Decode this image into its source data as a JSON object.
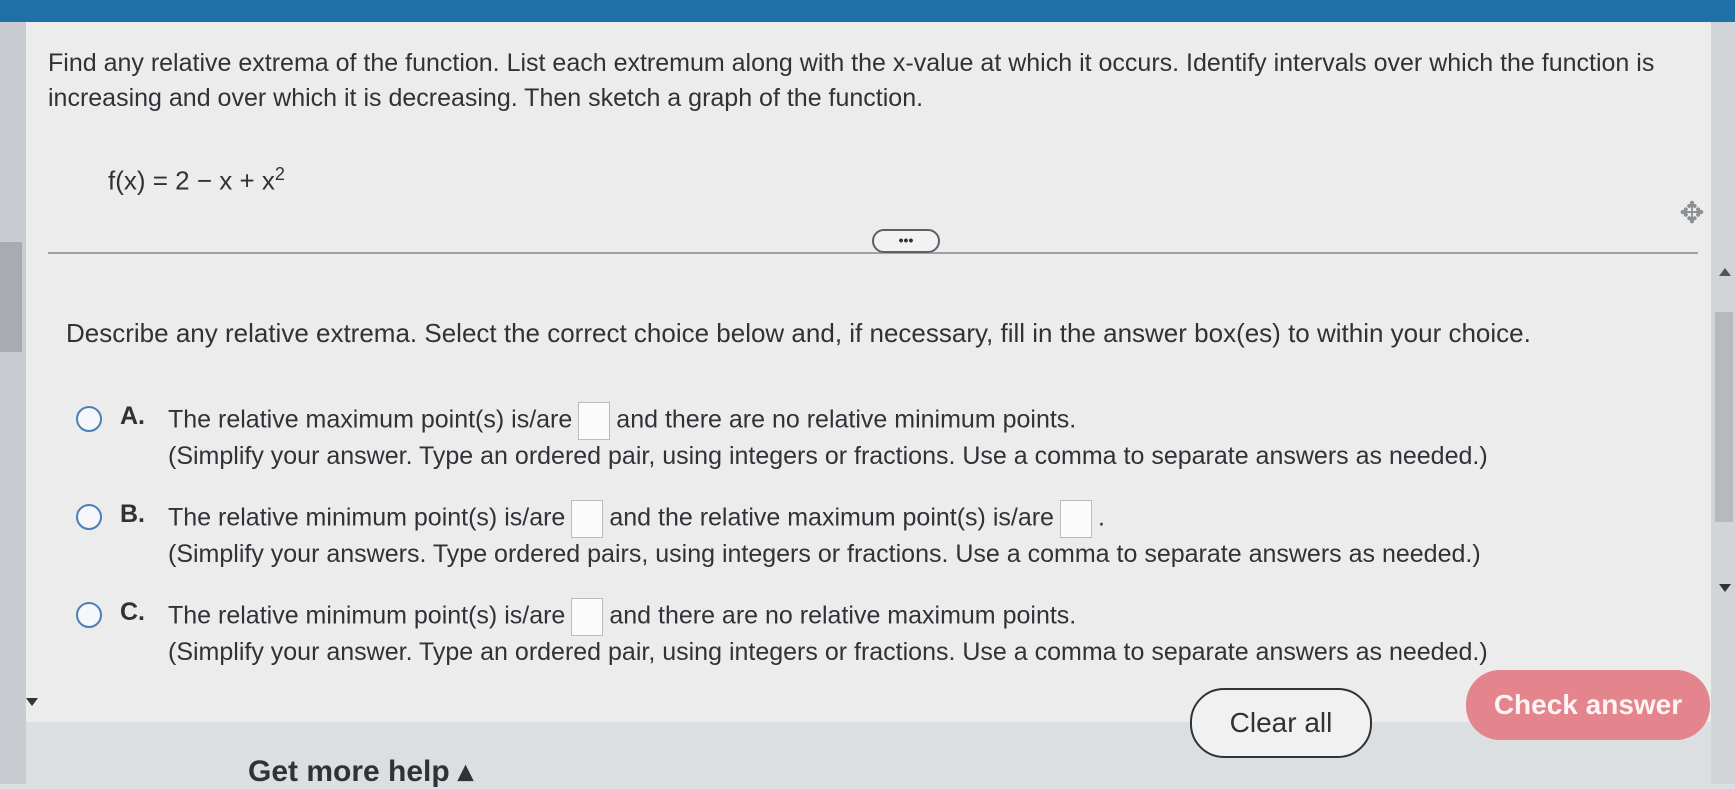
{
  "question": {
    "text": "Find any relative extrema of the function. List each extremum along with the x-value at which it occurs. Identify intervals over which the function is increasing and over which it is decreasing. Then sketch a graph of the function."
  },
  "function": {
    "lhs": "f(x) = 2 − x + x",
    "exponent": "2"
  },
  "more_button": "•••",
  "instruction": "Describe any relative extrema. Select the correct choice below and, if necessary, fill in the answer box(es) to within your choice.",
  "choices": [
    {
      "letter": "A.",
      "line1_a": "The relative maximum point(s) is/are",
      "line1_b": "and there are no relative minimum points.",
      "line2": "(Simplify your answer. Type an ordered pair, using integers or fractions. Use a comma to separate answers as needed.)"
    },
    {
      "letter": "B.",
      "line1_a": "The relative minimum point(s) is/are",
      "line1_b": "and the relative maximum point(s) is/are",
      "line1_c": ".",
      "line2": "(Simplify your answers. Type ordered pairs, using integers or fractions. Use a comma to separate answers as needed.)"
    },
    {
      "letter": "C.",
      "line1_a": "The relative minimum point(s) is/are",
      "line1_b": "and there are no relative maximum points.",
      "line2": "(Simplify your answer. Type an ordered pair, using integers or fractions. Use a comma to separate answers as needed.)"
    }
  ],
  "buttons": {
    "clear_all": "Clear all",
    "check_answer": "Check answer"
  },
  "help_link": "Get more help ▴",
  "icons": {
    "move": "move-handle-icon",
    "scroll_up": "scroll-up-icon",
    "scroll_down": "scroll-down-icon"
  },
  "colors": {
    "top_bar": "#1f6fa8",
    "check_answer_bg": "#e4848c",
    "radio_border": "#4a7fb8"
  }
}
